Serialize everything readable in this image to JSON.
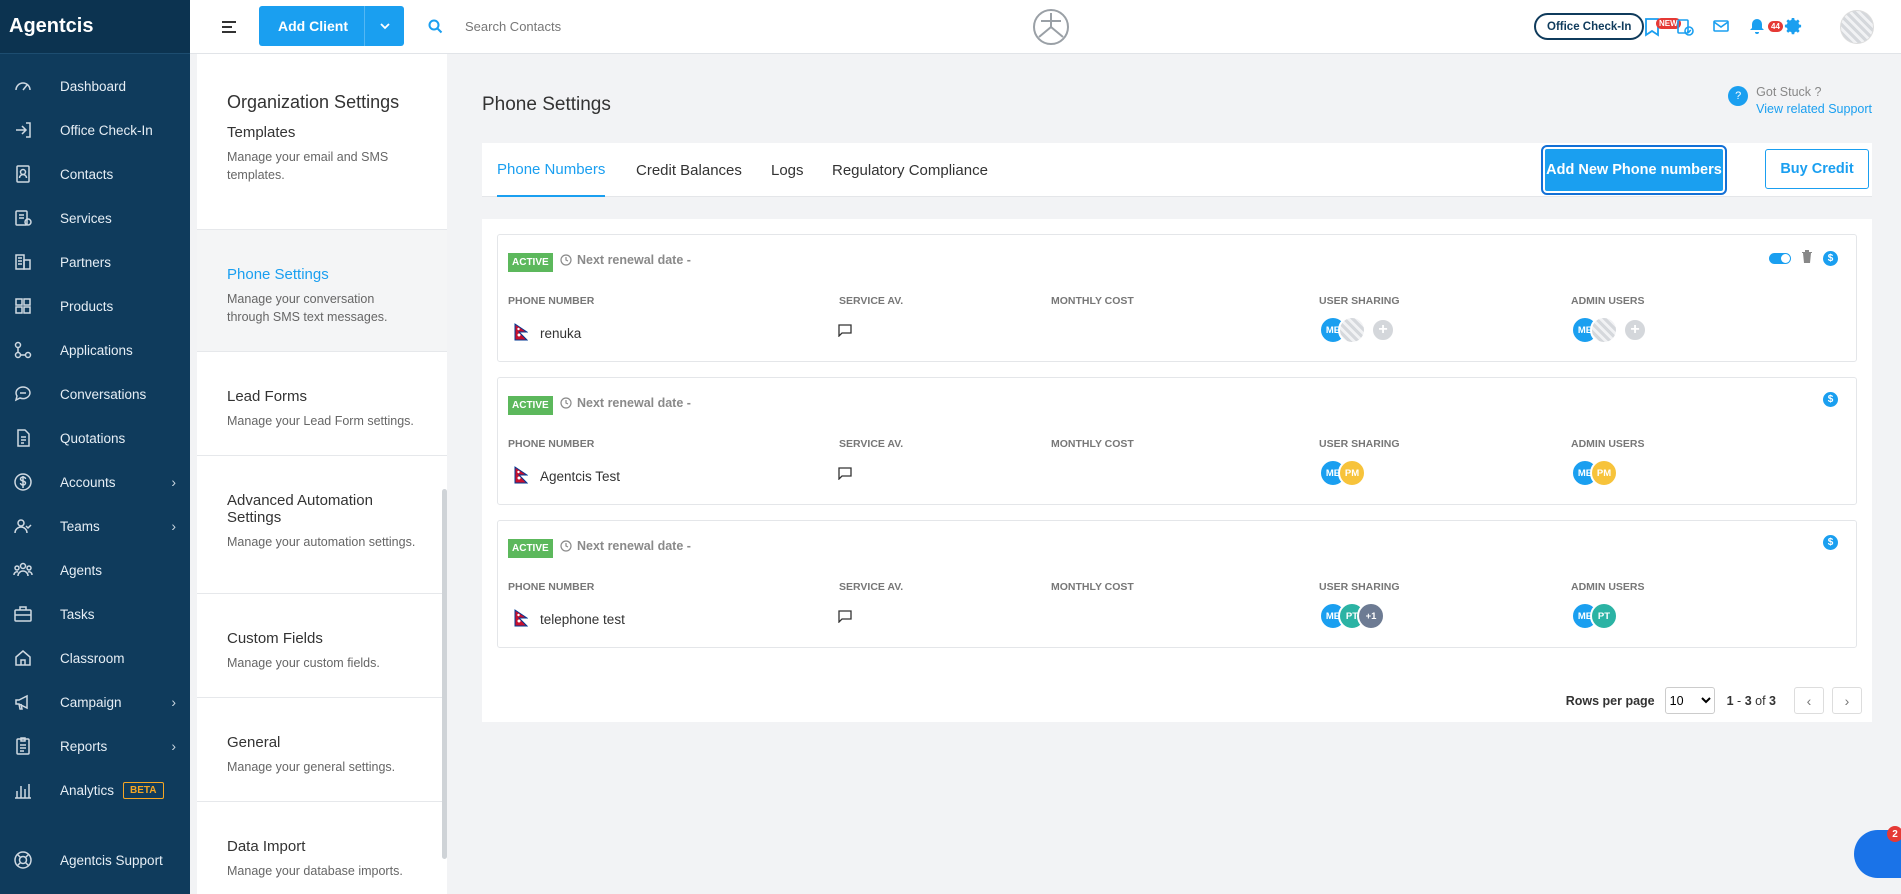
{
  "app": {
    "brand": "Agentcis"
  },
  "sidebar": {
    "items": [
      {
        "label": "Dashboard",
        "icon": "gauge-icon"
      },
      {
        "label": "Office Check-In",
        "icon": "checkin-icon"
      },
      {
        "label": "Contacts",
        "icon": "contacts-icon"
      },
      {
        "label": "Services",
        "icon": "services-icon"
      },
      {
        "label": "Partners",
        "icon": "building-icon"
      },
      {
        "label": "Products",
        "icon": "products-icon"
      },
      {
        "label": "Applications",
        "icon": "applications-icon"
      },
      {
        "label": "Conversations",
        "icon": "chat-icon"
      },
      {
        "label": "Quotations",
        "icon": "document-icon"
      },
      {
        "label": "Accounts",
        "icon": "dollar-icon",
        "expandable": true
      },
      {
        "label": "Teams",
        "icon": "team-icon",
        "expandable": true
      },
      {
        "label": "Agents",
        "icon": "agents-icon"
      },
      {
        "label": "Tasks",
        "icon": "briefcase-icon"
      },
      {
        "label": "Classroom",
        "icon": "classroom-icon"
      },
      {
        "label": "Campaign",
        "icon": "megaphone-icon",
        "expandable": true
      },
      {
        "label": "Reports",
        "icon": "clipboard-icon",
        "expandable": true
      },
      {
        "label": "Analytics",
        "icon": "chart-icon",
        "badge": "BETA"
      }
    ],
    "support_label": "Agentcis Support"
  },
  "topbar": {
    "add_client": "Add Client",
    "search_placeholder": "Search Contacts",
    "office_checkin": "Office Check-In",
    "new_badge": "NEW",
    "notif_count": "44"
  },
  "settings_menu": {
    "title": "Organization Settings",
    "items": [
      {
        "title": "Templates",
        "desc": "Manage your email and SMS templates."
      },
      {
        "title": "Phone Settings",
        "desc": "Manage your conversation through SMS text messages.",
        "active": true
      },
      {
        "title": "Lead Forms",
        "desc": "Manage your Lead Form settings."
      },
      {
        "title": "Advanced Automation Settings",
        "desc": "Manage your automation settings."
      },
      {
        "title": "Custom Fields",
        "desc": "Manage your custom fields."
      },
      {
        "title": "General",
        "desc": "Manage your general settings."
      },
      {
        "title": "Data Import",
        "desc": "Manage your database imports."
      }
    ]
  },
  "page": {
    "title": "Phone Settings",
    "help_q": "Got Stuck ?",
    "help_link": "View related Support",
    "tabs": [
      "Phone Numbers",
      "Credit Balances",
      "Logs",
      "Regulatory Compliance"
    ],
    "add_button": "Add New Phone numbers",
    "buy_button": "Buy Credit"
  },
  "columns": {
    "phone_number": "PHONE NUMBER",
    "service": "SERVICE AV.",
    "monthly_cost": "MONTHLY COST",
    "user_sharing": "USER SHARING",
    "admin_users": "ADMIN USERS"
  },
  "phones": [
    {
      "status": "ACTIVE",
      "renewal": "Next renewal date -",
      "name": "renuka",
      "user_sharing": [
        "ME",
        "IMG"
      ],
      "user_sharing_add": true,
      "admin_users": [
        "ME",
        "IMG"
      ],
      "admin_users_add": true,
      "has_toggle": true,
      "has_delete": true
    },
    {
      "status": "ACTIVE",
      "renewal": "Next renewal date -",
      "name": "Agentcis Test",
      "user_sharing": [
        "ME",
        "PM"
      ],
      "admin_users": [
        "ME",
        "PM"
      ]
    },
    {
      "status": "ACTIVE",
      "renewal": "Next renewal date -",
      "name": "telephone test",
      "user_sharing": [
        "ME",
        "PT",
        "+1"
      ],
      "admin_users": [
        "ME",
        "PT"
      ]
    }
  ],
  "pagination": {
    "rows_label": "Rows per page",
    "rows_value": "10",
    "range_start": "1",
    "range_end": "3",
    "range_of": "of",
    "total": "3"
  },
  "chat": {
    "badge": "2"
  },
  "colors": {
    "sidebar": "#0f3b5c",
    "accent": "#1a9ff0",
    "active_badge": "#5cb85c"
  }
}
